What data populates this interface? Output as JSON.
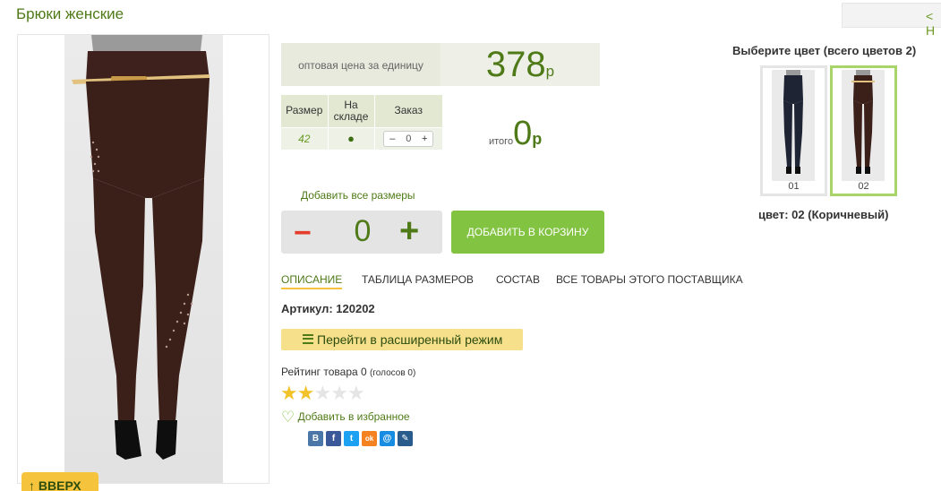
{
  "header": {
    "title": "Брюки женские",
    "back_label": "< Н"
  },
  "product_image": {
    "alt": "Брюки женские — коричневые"
  },
  "scroll_top": {
    "label": "↑ ВВЕРХ"
  },
  "price": {
    "label": "оптовая цена за единицу",
    "value": "378",
    "currency": "р"
  },
  "size_table": {
    "headers": [
      "Размер",
      "На складе",
      "Заказ"
    ],
    "rows": [
      {
        "size": "42",
        "in_stock": "●",
        "qty": "0"
      }
    ],
    "minus": "–",
    "plus": "+"
  },
  "total": {
    "label": "итого",
    "value": "0",
    "currency": "р"
  },
  "add_all_sizes": "Добавить все размеры",
  "quantity": {
    "minus": "−",
    "value": "0",
    "plus": "+"
  },
  "add_to_cart": "ДОБАВИТЬ В КОРЗИНУ",
  "tabs": [
    {
      "label": "ОПИСАНИЕ",
      "active": true
    },
    {
      "label": "ТАБЛИЦА РАЗМЕРОВ"
    },
    {
      "label": "СОСТАВ"
    },
    {
      "label": "ВСЕ ТОВАРЫ ЭТОГО ПОСТАВЩИКА"
    }
  ],
  "sku": "Артикул: 120202",
  "extended_mode": "Перейти в расширенный режим",
  "rating": {
    "text": "Рейтинг товара 0",
    "votes": "(голосов 0)",
    "stars_filled": 2,
    "stars_total": 5
  },
  "favorite": "Добавить в избранное",
  "social": [
    {
      "name": "vkontakte-icon",
      "glyph": "В",
      "color": "#4a76a8"
    },
    {
      "name": "facebook-icon",
      "glyph": "f",
      "color": "#3b5998"
    },
    {
      "name": "twitter-icon",
      "glyph": "t",
      "color": "#1da1f2"
    },
    {
      "name": "odnoklassniki-icon",
      "glyph": "ok",
      "color": "#f58220"
    },
    {
      "name": "mailru-icon",
      "glyph": "@",
      "color": "#168de2"
    },
    {
      "name": "livejournal-icon",
      "glyph": "✎",
      "color": "#2a5b8d"
    }
  ],
  "colors": {
    "title": "Выберите цвет (всего цветов 2)",
    "options": [
      {
        "code": "01",
        "shade": "#1e2433",
        "active": false
      },
      {
        "code": "02",
        "shade": "#3b201a",
        "active": true
      }
    ],
    "selected_text": "цвет: 02 (Коричневый)"
  },
  "theme": {
    "accent": "#82c341",
    "title_green": "#4e7a17",
    "yellow": "#f6c33c"
  }
}
